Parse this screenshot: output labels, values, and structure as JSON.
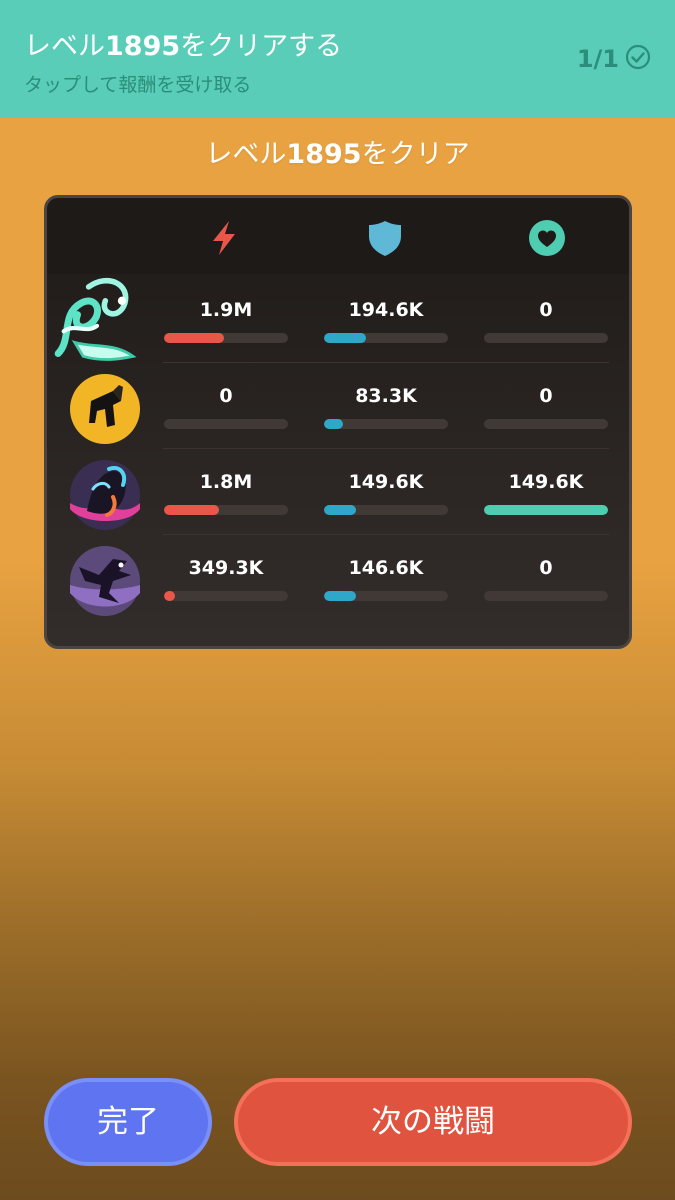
{
  "quest": {
    "title_prefix": "レベル",
    "title_level": "1895",
    "title_suffix": "をクリアする",
    "subtitle": "タップして報酬を受け取る",
    "progress": "1/1"
  },
  "result": {
    "title_prefix": "レベル",
    "title_level": "1895",
    "title_suffix": "をクリア"
  },
  "columns": [
    {
      "icon": "lightning-icon",
      "color": "#e8574a"
    },
    {
      "icon": "shield-icon",
      "color": "#5fb8d6"
    },
    {
      "icon": "heart-icon",
      "color": "#4ecdb1"
    }
  ],
  "heroes": [
    {
      "avatar": "dragon-hero-avatar",
      "damage": "1.9M",
      "damage_pct": 0.48,
      "defense": "194.6K",
      "defense_pct": 0.34,
      "heal": "0",
      "heal_pct": 0
    },
    {
      "avatar": "golden-hero-avatar",
      "damage": "0",
      "damage_pct": 0,
      "defense": "83.3K",
      "defense_pct": 0.15,
      "heal": "0",
      "heal_pct": 0
    },
    {
      "avatar": "neon-hero-avatar",
      "damage": "1.8M",
      "damage_pct": 0.44,
      "defense": "149.6K",
      "defense_pct": 0.26,
      "heal": "149.6K",
      "heal_pct": 1.0
    },
    {
      "avatar": "shadow-dragon-avatar",
      "damage": "349.3K",
      "damage_pct": 0.09,
      "defense": "146.6K",
      "defense_pct": 0.26,
      "heal": "0",
      "heal_pct": 0
    }
  ],
  "buttons": {
    "done": "完了",
    "next": "次の戦闘"
  },
  "colors": {
    "banner": "#59cdb7",
    "background": "#e8a241",
    "damage": "#e8574a",
    "defense": "#2ea7c9",
    "heal": "#4ecdb1",
    "done_button": "#5f74f0",
    "next_button": "#e0543f"
  }
}
